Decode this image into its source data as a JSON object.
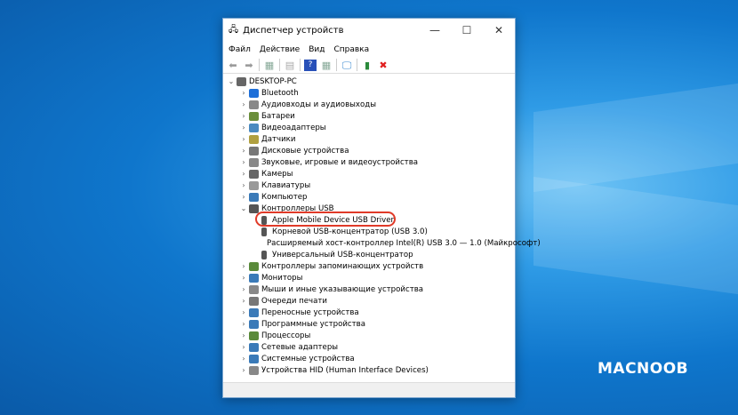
{
  "window": {
    "title": "Диспетчер устройств",
    "minimize": "—",
    "maximize": "☐",
    "close": "✕"
  },
  "menu": [
    "Файл",
    "Действие",
    "Вид",
    "Справка"
  ],
  "toolbar": [
    "back",
    "forward",
    "properties",
    "update",
    "help",
    "view",
    "monitor",
    "enable",
    "remove"
  ],
  "tree": {
    "root": "DESKTOP-PC",
    "items": [
      {
        "label": "Bluetooth",
        "color": "#1e6fd8"
      },
      {
        "label": "Аудиовходы и аудиовыходы",
        "color": "#888"
      },
      {
        "label": "Батареи",
        "color": "#6a8e3a"
      },
      {
        "label": "Видеоадаптеры",
        "color": "#4a8ac0"
      },
      {
        "label": "Датчики",
        "color": "#b0a040"
      },
      {
        "label": "Дисковые устройства",
        "color": "#777"
      },
      {
        "label": "Звуковые, игровые и видеоустройства",
        "color": "#888"
      },
      {
        "label": "Камеры",
        "color": "#666"
      },
      {
        "label": "Клавиатуры",
        "color": "#999"
      },
      {
        "label": "Компьютер",
        "color": "#3a7ab8"
      },
      {
        "label": "Контроллеры USB",
        "color": "#555",
        "expanded": true,
        "children": [
          "Apple Mobile Device USB Driver",
          "Корневой USB-концентратор (USB 3.0)",
          "Расширяемый хост-контроллер Intel(R) USB 3.0 — 1.0 (Майкрософт)",
          "Универсальный USB-концентратор"
        ]
      },
      {
        "label": "Контроллеры запоминающих устройств",
        "color": "#5a8a3a"
      },
      {
        "label": "Мониторы",
        "color": "#3a7ab8"
      },
      {
        "label": "Мыши и иные указывающие устройства",
        "color": "#888"
      },
      {
        "label": "Очереди печати",
        "color": "#777"
      },
      {
        "label": "Переносные устройства",
        "color": "#3a7ab8"
      },
      {
        "label": "Программные устройства",
        "color": "#3a7ab8"
      },
      {
        "label": "Процессоры",
        "color": "#5a8a3a"
      },
      {
        "label": "Сетевые адаптеры",
        "color": "#3a7ab8"
      },
      {
        "label": "Системные устройства",
        "color": "#3a7ab8"
      },
      {
        "label": "Устройства HID (Human Interface Devices)",
        "color": "#888"
      }
    ]
  },
  "highlight_color": "#e03a28",
  "logo": "MACNOOB"
}
